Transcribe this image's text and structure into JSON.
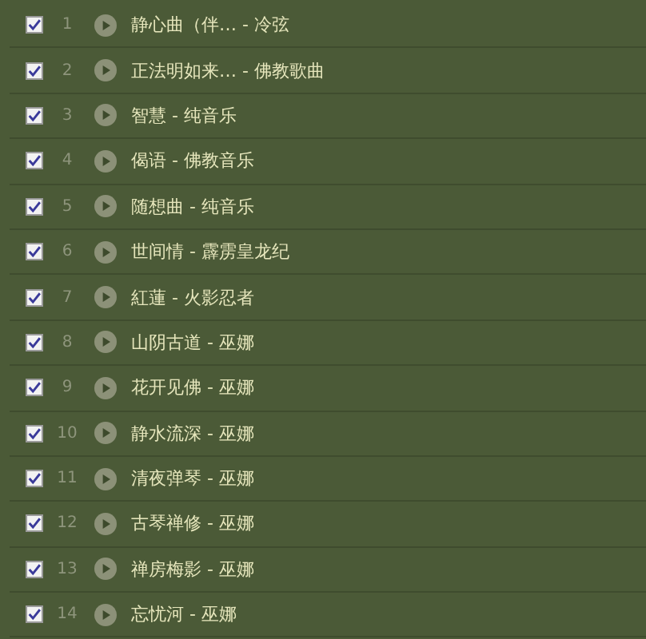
{
  "tracks": [
    {
      "checked": true,
      "number": "1",
      "title": "静心曲（伴… - 冷弦"
    },
    {
      "checked": true,
      "number": "2",
      "title": "正法明如来… - 佛教歌曲"
    },
    {
      "checked": true,
      "number": "3",
      "title": "智慧 - 纯音乐"
    },
    {
      "checked": true,
      "number": "4",
      "title": "偈语 - 佛教音乐"
    },
    {
      "checked": true,
      "number": "5",
      "title": "随想曲 - 纯音乐"
    },
    {
      "checked": true,
      "number": "6",
      "title": "世间情 - 霹雳皇龙纪"
    },
    {
      "checked": true,
      "number": "7",
      "title": "紅蓮 - 火影忍者"
    },
    {
      "checked": true,
      "number": "8",
      "title": "山阴古道 - 巫娜"
    },
    {
      "checked": true,
      "number": "9",
      "title": "花开见佛 - 巫娜"
    },
    {
      "checked": true,
      "number": "10",
      "title": "静水流深 - 巫娜"
    },
    {
      "checked": true,
      "number": "11",
      "title": "清夜弹琴 - 巫娜"
    },
    {
      "checked": true,
      "number": "12",
      "title": "古琴禅修 - 巫娜"
    },
    {
      "checked": true,
      "number": "13",
      "title": "禅房梅影 - 巫娜"
    },
    {
      "checked": true,
      "number": "14",
      "title": "忘忧河 - 巫娜"
    }
  ]
}
